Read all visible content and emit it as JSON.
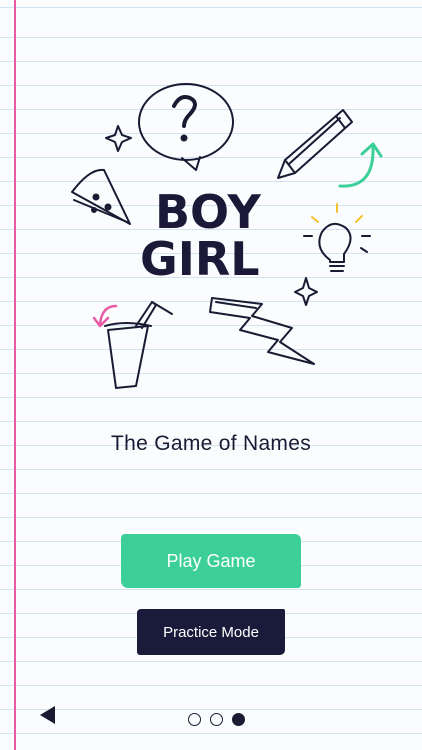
{
  "logo": {
    "line1": "BOY",
    "line2": "GIRL"
  },
  "title": "The Game of Names",
  "buttons": {
    "play": "Play Game",
    "practice": "Practice Mode"
  },
  "pagination": {
    "total": 3,
    "active_index": 2
  },
  "colors": {
    "accent_green": "#3dcf98",
    "navy": "#1a1a3a",
    "margin_pink": "#e85aa6",
    "ruled_line": "#cfe6f2"
  },
  "icons": [
    "question-bubble-icon",
    "pencil-icon",
    "pizza-slice-icon",
    "lightbulb-icon",
    "drink-cup-icon",
    "lightning-bolt-icon",
    "curved-arrow-icon",
    "sparkle-icon",
    "back-arrow-icon"
  ]
}
